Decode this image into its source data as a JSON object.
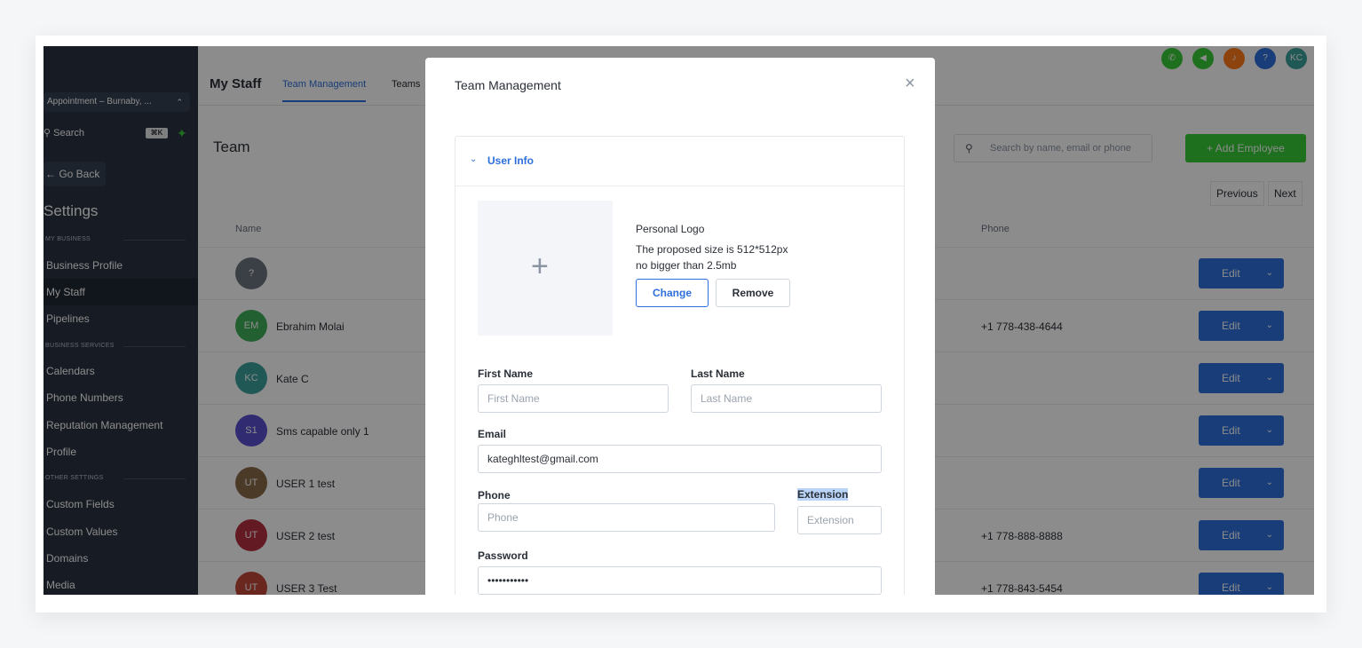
{
  "sidebar": {
    "location_select": "Appointment – Burnaby, ...",
    "search_placeholder": "Search",
    "search_shortcut": "⌘K",
    "back_label": "← Go Back",
    "title": "Settings",
    "sections": {
      "my_business": "MY BUSINESS",
      "business_services": "BUSINESS SERVICES",
      "other_settings": "OTHER SETTINGS"
    },
    "items": [
      {
        "label": "Business Profile"
      },
      {
        "label": "My Staff"
      },
      {
        "label": "Pipelines"
      },
      {
        "label": "Calendars"
      },
      {
        "label": "Phone Numbers"
      },
      {
        "label": "Reputation Management"
      },
      {
        "label": "Profile"
      },
      {
        "label": "Custom Fields"
      },
      {
        "label": "Custom Values"
      },
      {
        "label": "Domains"
      },
      {
        "label": "Media"
      }
    ]
  },
  "header": {
    "title": "My Staff",
    "tabs": [
      {
        "label": "Team Management"
      },
      {
        "label": "Teams"
      }
    ],
    "icons": {
      "phone": "phone-icon",
      "megaphone": "megaphone-icon",
      "bell": "bell-icon",
      "help": "?",
      "user_initials": "KC"
    }
  },
  "team": {
    "heading": "Team",
    "search_placeholder": "Search by name, email or phone",
    "add_button": "+ Add Employee",
    "previous": "Previous",
    "next": "Next",
    "columns": {
      "name": "Name",
      "phone": "Phone"
    },
    "rows": [
      {
        "initials": "?",
        "name": "",
        "phone": "",
        "color": "#6c7480"
      },
      {
        "initials": "EM",
        "name": "Ebrahim Molai",
        "phone": "+1 778-438-4644",
        "color": "#3fae5a"
      },
      {
        "initials": "KC",
        "name": "Kate C",
        "phone": "",
        "color": "#3aa19a"
      },
      {
        "initials": "S1",
        "name": "Sms capable only 1",
        "phone": "",
        "color": "#5a4fcf"
      },
      {
        "initials": "UT",
        "name": "USER 1 test",
        "phone": "",
        "color": "#8b6b4a"
      },
      {
        "initials": "UT",
        "name": "USER 2 test",
        "phone": "+1 778-888-8888",
        "color": "#b7313f"
      },
      {
        "initials": "UT",
        "name": "USER 3 Test",
        "phone": "+1 778-843-5454",
        "color": "#c0473a"
      }
    ],
    "edit_label": "Edit"
  },
  "modal": {
    "title": "Team Management",
    "accordion_label": "User Info",
    "logo": {
      "title": "Personal Logo",
      "size_hint": "The proposed size is 512*512px",
      "limit_hint": "no bigger than 2.5mb",
      "change_label": "Change",
      "remove_label": "Remove"
    },
    "fields": {
      "first_name": {
        "label": "First Name",
        "placeholder": "First Name",
        "value": ""
      },
      "last_name": {
        "label": "Last Name",
        "placeholder": "Last Name",
        "value": ""
      },
      "email": {
        "label": "Email",
        "value": "kateghltest@gmail.com"
      },
      "phone": {
        "label": "Phone",
        "placeholder": "Phone",
        "value": ""
      },
      "extension": {
        "label": "Extension",
        "placeholder": "Extension",
        "value": ""
      },
      "password": {
        "label": "Password",
        "value": "•••••••••••"
      }
    }
  },
  "colors": {
    "sidebar_bg": "#2a3240",
    "primary": "#2d6fdb",
    "success": "#37ca37",
    "overlay": "rgba(0,0,0,0.45)"
  }
}
